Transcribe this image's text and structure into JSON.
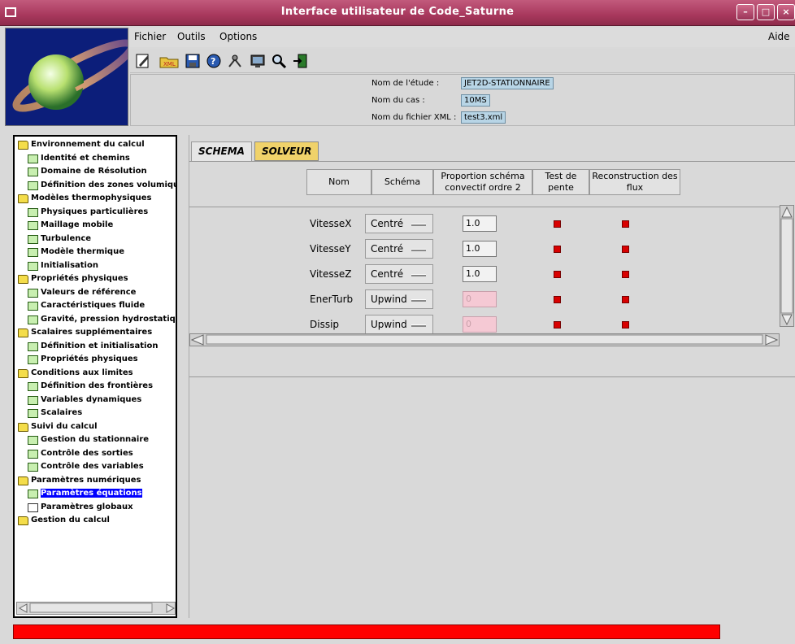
{
  "window": {
    "title": "Interface utilisateur de Code_Saturne",
    "buttons": {
      "minimize": "–",
      "maximize": "□",
      "close": "×"
    }
  },
  "menu": {
    "fichier": "Fichier",
    "outils": "Outils",
    "options": "Options",
    "aide": "Aide"
  },
  "toolbar": {
    "icons": [
      "edit-icon",
      "open-xml-icon",
      "save-icon",
      "help-icon",
      "tools-icon",
      "screen-icon",
      "search-icon",
      "exit-icon"
    ]
  },
  "study": {
    "etude_label": "Nom de l'étude :",
    "etude_value": "JET2D-STATIONNAIRE",
    "cas_label": "Nom du cas :",
    "cas_value": "10MS",
    "xml_label": "Nom du fichier XML :",
    "xml_value": "test3.xml"
  },
  "tree": {
    "items": [
      {
        "label": "Environnement du calcul",
        "type": "folder"
      },
      {
        "label": "Identité et chemins",
        "type": "doc"
      },
      {
        "label": "Domaine de Résolution",
        "type": "doc"
      },
      {
        "label": "Définition des zones volumiques",
        "type": "doc"
      },
      {
        "label": "Modèles thermophysiques",
        "type": "folder"
      },
      {
        "label": "Physiques particulières",
        "type": "doc"
      },
      {
        "label": "Maillage mobile",
        "type": "doc"
      },
      {
        "label": "Turbulence",
        "type": "doc"
      },
      {
        "label": "Modèle thermique",
        "type": "doc"
      },
      {
        "label": "Initialisation",
        "type": "doc"
      },
      {
        "label": "Propriétés physiques",
        "type": "folder"
      },
      {
        "label": "Valeurs de référence",
        "type": "doc"
      },
      {
        "label": "Caractéristiques fluide",
        "type": "doc"
      },
      {
        "label": "Gravité, pression hydrostatique",
        "type": "doc"
      },
      {
        "label": "Scalaires supplémentaires",
        "type": "folder"
      },
      {
        "label": "Définition et initialisation",
        "type": "doc"
      },
      {
        "label": "Propriétés physiques",
        "type": "doc"
      },
      {
        "label": "Conditions aux limites",
        "type": "folder"
      },
      {
        "label": "Définition des frontières",
        "type": "doc"
      },
      {
        "label": "Variables dynamiques",
        "type": "doc"
      },
      {
        "label": "Scalaires",
        "type": "doc"
      },
      {
        "label": "Suivi du calcul",
        "type": "folder"
      },
      {
        "label": "Gestion du stationnaire",
        "type": "doc"
      },
      {
        "label": "Contrôle des sorties",
        "type": "doc"
      },
      {
        "label": "Contrôle des variables",
        "type": "doc"
      },
      {
        "label": "Paramètres numériques",
        "type": "folder"
      },
      {
        "label": "Paramètres équations",
        "type": "doc",
        "selected": true
      },
      {
        "label": "Paramètres globaux",
        "type": "doc-white"
      },
      {
        "label": "Gestion du calcul",
        "type": "folder-closed"
      }
    ]
  },
  "tabs": {
    "schema": "SCHEMA",
    "solveur": "SOLVEUR"
  },
  "table": {
    "headers": {
      "nom": "Nom",
      "schema": "Schéma",
      "proportion": "Proportion schéma convectif ordre 2",
      "test": "Test de pente",
      "reconstruction": "Reconstruction des flux"
    },
    "rows": [
      {
        "nom": "VitesseX",
        "schema": "Centré",
        "proportion": "1.0",
        "enabled": true
      },
      {
        "nom": "VitesseY",
        "schema": "Centré",
        "proportion": "1.0",
        "enabled": true
      },
      {
        "nom": "VitesseZ",
        "schema": "Centré",
        "proportion": "1.0",
        "enabled": true
      },
      {
        "nom": "EnerTurb",
        "schema": "Upwind",
        "proportion": "0",
        "enabled": false
      },
      {
        "nom": "Dissip",
        "schema": "Upwind",
        "proportion": "0",
        "enabled": false
      }
    ]
  },
  "colors": {
    "titlebar": "#a8385d",
    "selection": "#0000ff",
    "statusbar": "#ff0000",
    "flag": "#d80000"
  }
}
